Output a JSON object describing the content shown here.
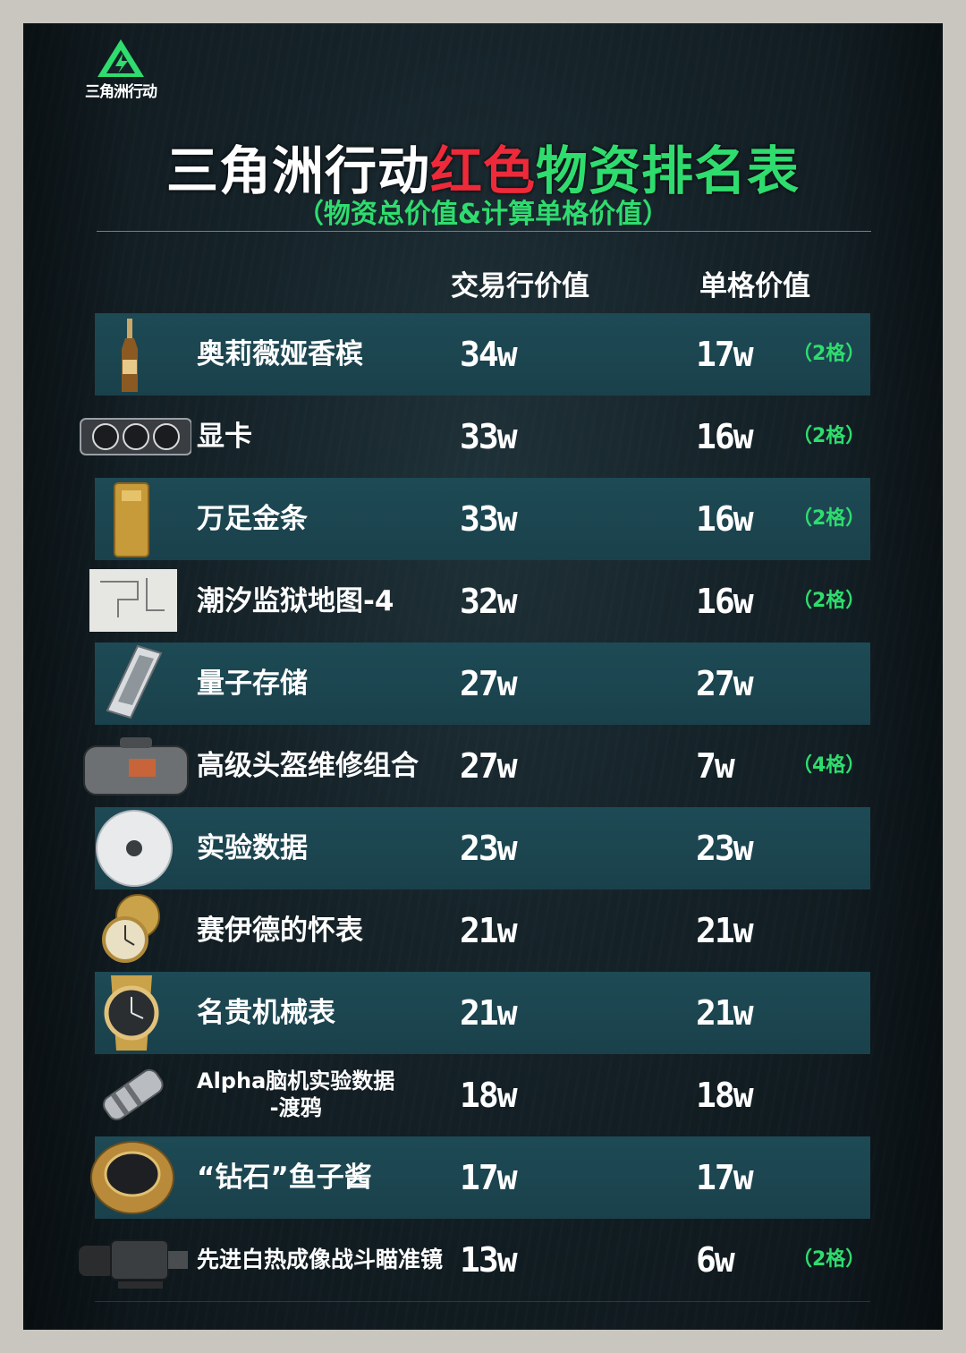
{
  "logo": {
    "text": "三角洲行动"
  },
  "title": {
    "part1": "三角洲行动",
    "part2": "红色",
    "part3": "物资排名表"
  },
  "subtitle": "（物资总价值&计算单格价值）",
  "columns": {
    "price": "交易行价值",
    "unit": "单格价值"
  },
  "colors": {
    "accent_green": "#2fdc6e",
    "accent_red": "#ee2a3a",
    "row_shade": "#1d4a55"
  },
  "rows": [
    {
      "name": "奥莉薇娅香槟",
      "price": "34w",
      "unit": "17w",
      "slots": "（2格）",
      "icon": "champagne-bottle-icon"
    },
    {
      "name": "显卡",
      "price": "33w",
      "unit": "16w",
      "slots": "（2格）",
      "icon": "graphics-card-icon"
    },
    {
      "name": "万足金条",
      "price": "33w",
      "unit": "16w",
      "slots": "（2格）",
      "icon": "gold-bar-icon"
    },
    {
      "name": "潮汐监狱地图-4",
      "price": "32w",
      "unit": "16w",
      "slots": "（2格）",
      "icon": "prison-map-icon"
    },
    {
      "name": "量子存储",
      "price": "27w",
      "unit": "27w",
      "slots": "",
      "icon": "quantum-storage-icon"
    },
    {
      "name": "高级头盔维修组合",
      "price": "27w",
      "unit": "7w",
      "slots": "（4格）",
      "icon": "repair-bag-icon"
    },
    {
      "name": "实验数据",
      "price": "23w",
      "unit": "23w",
      "slots": "",
      "icon": "disc-icon"
    },
    {
      "name": "赛伊德的怀表",
      "price": "21w",
      "unit": "21w",
      "slots": "",
      "icon": "pocket-watch-icon"
    },
    {
      "name": "名贵机械表",
      "price": "21w",
      "unit": "21w",
      "slots": "",
      "icon": "wristwatch-icon"
    },
    {
      "name_line1": "Alpha脑机实验数据",
      "name_line2": "-渡鸦",
      "price": "18w",
      "unit": "18w",
      "slots": "",
      "icon": "data-capsule-icon"
    },
    {
      "name": "“钻石”鱼子酱",
      "price": "17w",
      "unit": "17w",
      "slots": "",
      "icon": "caviar-tin-icon"
    },
    {
      "name": "先进白热成像战斗瞄准镜",
      "price": "13w",
      "unit": "6w",
      "slots": "（2格）",
      "icon": "thermal-scope-icon"
    }
  ]
}
